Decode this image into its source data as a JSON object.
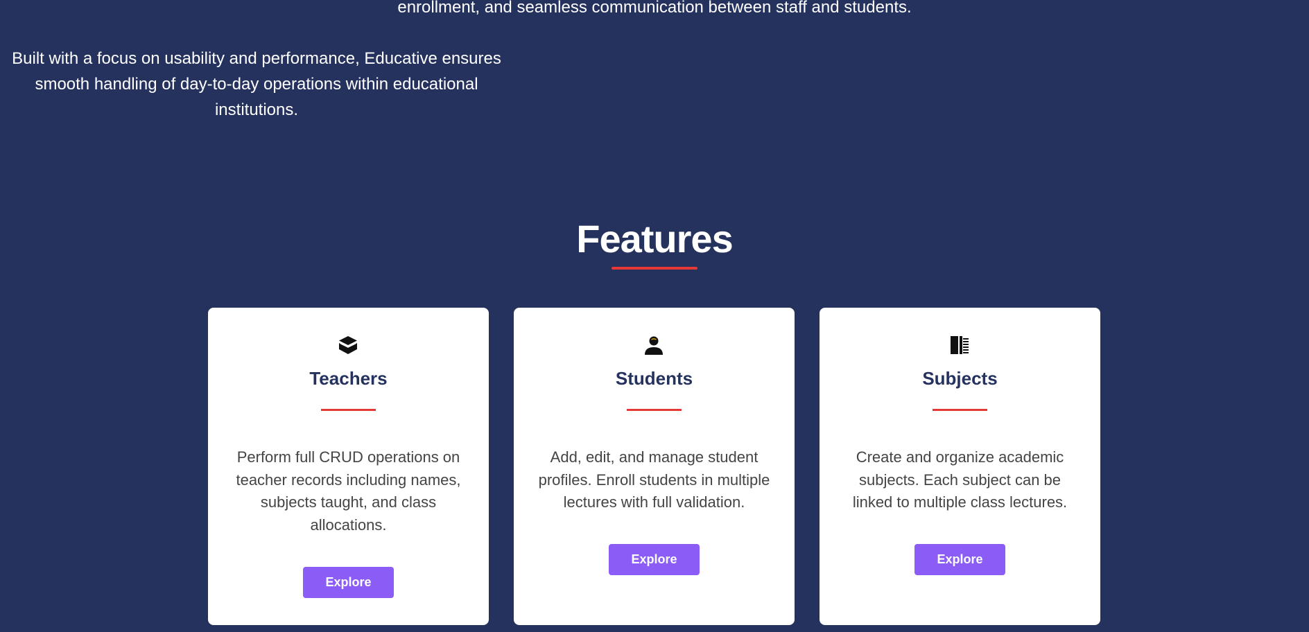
{
  "intro": {
    "line_top": "enrollment, and seamless communication between staff and students.",
    "paragraph": "Built with a focus on usability and performance, Educative ensures smooth handling of day-to-day operations within educational institutions."
  },
  "features": {
    "title": "Features",
    "cards": [
      {
        "icon": "teacher-stack-icon",
        "title": "Teachers",
        "description": "Perform full CRUD operations on teacher records including names, subjects taught, and class allocations.",
        "button": "Explore"
      },
      {
        "icon": "student-person-icon",
        "title": "Students",
        "description": "Add, edit, and manage student profiles. Enroll students in multiple lectures with full validation.",
        "button": "Explore"
      },
      {
        "icon": "book-icon",
        "title": "Subjects",
        "description": "Create and organize academic subjects. Each subject can be linked to multiple class lectures.",
        "button": "Explore"
      }
    ]
  },
  "colors": {
    "background": "#25325d",
    "accent_red": "#e53935",
    "button_purple": "#8b5cf6",
    "card_title": "#25325d"
  }
}
